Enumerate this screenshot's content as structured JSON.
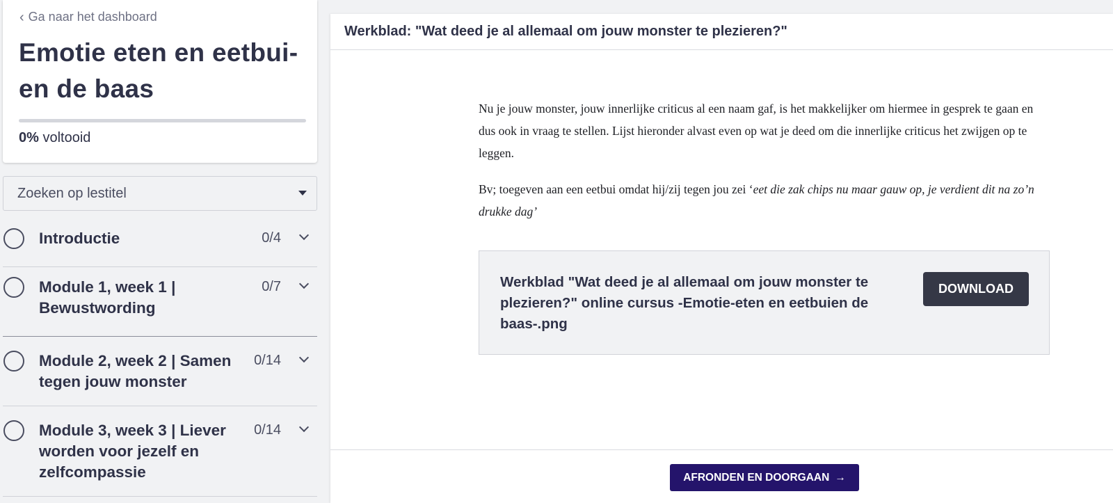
{
  "sidebar": {
    "back_link": "Ga naar het dashboard",
    "course_title": "Emotie eten en eetbui-en de baas",
    "progress": {
      "percent_label": "0%",
      "suffix": "voltooid",
      "value": 0
    },
    "search_placeholder": "Zoeken op lestitel",
    "modules": [
      {
        "title": "Introductie",
        "count": "0/4"
      },
      {
        "title": "Module 1, week 1 | Bewustwording",
        "count": "0/7"
      },
      {
        "title": "Module 2, week 2 | Samen tegen jouw monster",
        "count": "0/14"
      },
      {
        "title": "Module 3, week 3 | Liever worden voor jezelf en zelfcompassie",
        "count": "0/14"
      }
    ]
  },
  "main": {
    "header_title": "Werkblad: \"Wat deed je al allemaal om jouw monster te plezieren?\"",
    "paragraph1": "Nu je jouw monster, jouw innerlijke criticus al een naam gaf, is het makkelijker om hiermee in gesprek te gaan en dus ook in vraag te stellen. Lijst hieronder alvast even op wat je deed om die innerlijke criticus het zwijgen op te leggen.",
    "paragraph2_prefix": "Bv; toegeven aan een eetbui omdat hij/zij tegen jou zei ‘",
    "paragraph2_quote": "eet die zak chips nu maar gauw op, je verdient dit na zo’n drukke dag’",
    "download": {
      "file_title": "Werkblad \"Wat deed je al allemaal om jouw monster te plezieren?\" online cursus -Emotie-eten en eetbuien de baas-.png",
      "button_label": "DOWNLOAD"
    },
    "finish_button": "AFRONDEN EN DOORGAAN"
  },
  "colors": {
    "accent": "#24146b",
    "dark_button": "#353846",
    "text": "#2f3248",
    "background": "#f1f2f4"
  }
}
